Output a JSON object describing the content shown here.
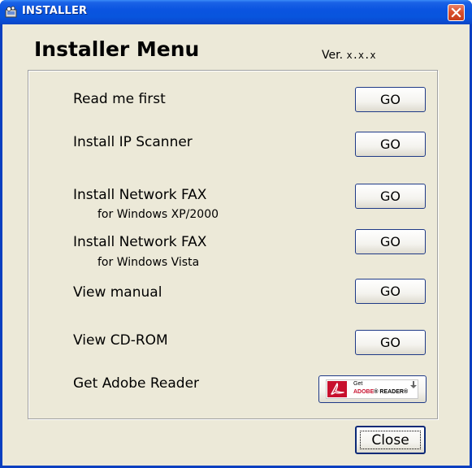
{
  "window": {
    "title": "INSTALLER",
    "titlebar_color": "#0a54e0",
    "close_button_color": "#d9502d",
    "icon": "installer-app-icon"
  },
  "header": {
    "heading": "Installer Menu",
    "version_label": "Ver.",
    "version_number": "x.x.x"
  },
  "menu": {
    "items": [
      {
        "label": "Read me first",
        "subtitle": "",
        "button_label": "GO"
      },
      {
        "label": "Install IP Scanner",
        "subtitle": "",
        "button_label": "GO"
      },
      {
        "label": "Install Network FAX",
        "subtitle": "for Windows XP/2000",
        "button_label": "GO"
      },
      {
        "label": "Install Network FAX",
        "subtitle": "for Windows Vista",
        "button_label": "GO"
      },
      {
        "label": "View manual",
        "subtitle": "",
        "button_label": "GO"
      },
      {
        "label": "View CD-ROM",
        "subtitle": "",
        "button_label": "GO"
      },
      {
        "label": "Get Adobe Reader",
        "subtitle": "",
        "button_label": ""
      }
    ],
    "adobe_badge": {
      "get_text": "Get",
      "adobe_text": "ADOBE",
      "reader_text": "READER",
      "brand_color": "#c8102e",
      "icon": "adobe-reader-logo-icon"
    }
  },
  "footer": {
    "close_label": "Close"
  }
}
